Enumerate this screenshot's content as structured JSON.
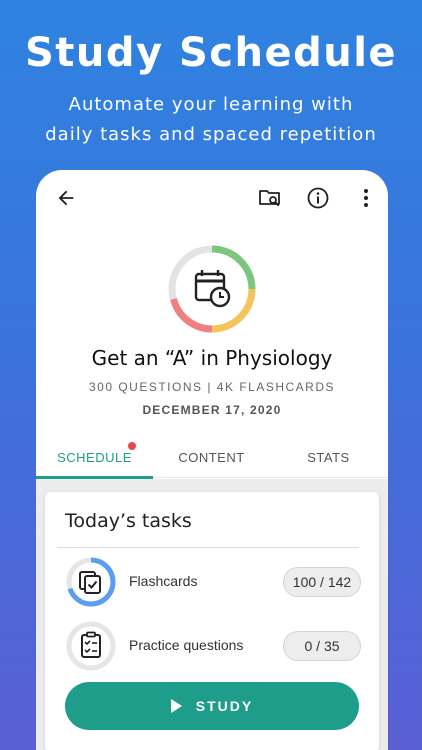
{
  "hero": {
    "title": "Study Schedule",
    "subtitle_line1": "Automate your learning with",
    "subtitle_line2": "daily tasks and spaced repetition"
  },
  "toolbar": {
    "icons": [
      "back-arrow-icon",
      "folder-search-icon",
      "info-icon",
      "more-vertical-icon"
    ]
  },
  "goal": {
    "icon": "calendar-clock-icon",
    "title": "Get an “A” in Physiology",
    "meta": "300 QUESTIONS | 4K FLASHCARDS",
    "date": "DECEMBER 17, 2020",
    "ring_colors": [
      "#7dc67f",
      "#f4c45d",
      "#f07f7f",
      "#e3e3e3"
    ]
  },
  "tabs": [
    {
      "label": "SCHEDULE",
      "active": true,
      "has_notification": true
    },
    {
      "label": "CONTENT",
      "active": false
    },
    {
      "label": "STATS",
      "active": false
    }
  ],
  "tasks_card": {
    "title": "Today’s tasks",
    "tasks": [
      {
        "label": "Flashcards",
        "count": "100 / 142",
        "progress": 0.7,
        "icon": "flashcards-icon"
      },
      {
        "label": "Practice questions",
        "count": "0 / 35",
        "progress": 0,
        "icon": "clipboard-checklist-icon"
      }
    ],
    "study_button": "STUDY"
  },
  "colors": {
    "accent": "#1e9e8a",
    "progress_blue": "#5a9ef0",
    "notification": "#e5484d"
  }
}
